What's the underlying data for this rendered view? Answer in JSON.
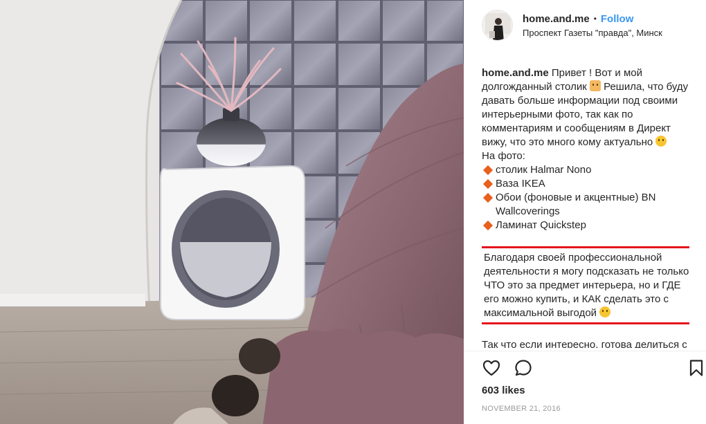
{
  "post": {
    "username": "home.and.me",
    "separator": "•",
    "follow_label": "Follow",
    "location": "Проспект Газеты \"правда\", Минск"
  },
  "caption": {
    "username": "home.and.me",
    "intro_1": "Привет ! Вот и мой долгожданный столик",
    "intro_2": "Решила, что буду давать больше информации под своими интерьерными фото, так как по комментариям и сообщениям в Директ вижу, что это много кому актуально",
    "photo_heading": "На фото:",
    "items": [
      "столик Halmar Nono",
      "Ваза IKEA",
      "Обои (фоновые и акцентные) BN Wallcoverings",
      "Ламинат Quickstep"
    ],
    "highlight": "Благодаря своей профессиональной деятельности я могу подсказать не только ЧТО это за предмет интерьера, но и ГДЕ его можно купить, и КАК сделать это с максимальной выгодой",
    "outro": "Так что если интересно, готова делиться с вами полезными ссылками, а ещё"
  },
  "footer": {
    "likes": "603 likes",
    "date": "NOVEMBER 21, 2016"
  },
  "icons": {
    "like": "heart-icon",
    "comment": "comment-icon",
    "save": "bookmark-icon"
  },
  "colors": {
    "follow": "#3897f0",
    "highlight_border": "#e4141c",
    "bullet": "#e8601c"
  }
}
